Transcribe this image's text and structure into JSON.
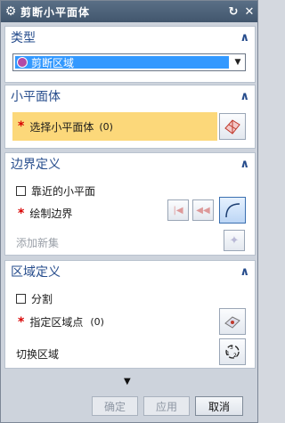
{
  "window": {
    "title": "剪断小平面体",
    "icon": "gear-icon",
    "reset_icon": "refresh-icon",
    "close_icon": "close-icon"
  },
  "type_panel": {
    "header": "类型",
    "selected_value": "剪断区域",
    "value_icon": "trim-region-icon"
  },
  "facet_panel": {
    "header": "小平面体",
    "select_label": "选择小平面体",
    "select_count": "(0)",
    "icon": "facet-body-icon"
  },
  "boundary_panel": {
    "header": "边界定义",
    "nearby_label": "靠近的小平面",
    "draw_label": "绘制边界",
    "add_new_set_label": "添加新集"
  },
  "region_panel": {
    "header": "区域定义",
    "split_label": "分割",
    "point_label": "指定区域点",
    "point_count": "(0)",
    "toggle_label": "切换区域"
  },
  "footer": {
    "ok_label": "确定",
    "apply_label": "应用",
    "cancel_label": "取消"
  },
  "colors": {
    "accent": "#264c8c",
    "highlight": "#fcd87a",
    "required": "#d80000",
    "selection": "#3399ff"
  }
}
